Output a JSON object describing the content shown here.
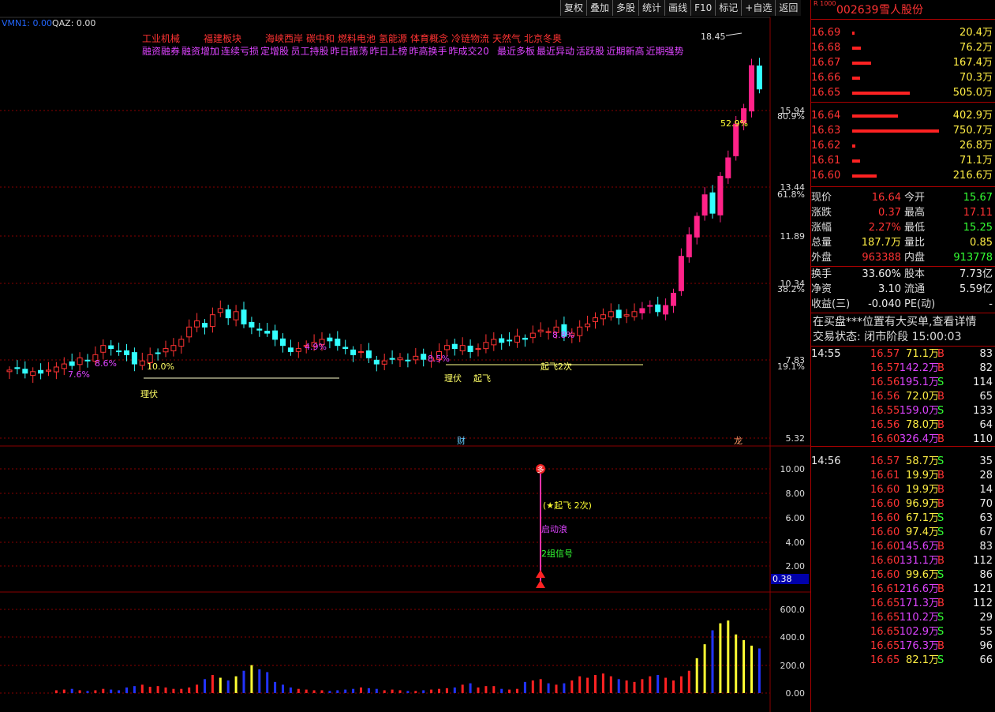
{
  "toolbar": [
    "复权",
    "叠加",
    "多股",
    "统计",
    "画线",
    "F10",
    "标记",
    "+自选",
    "返回"
  ],
  "indicator_line": {
    "vmn": "VMN1: 0.00",
    "qaz": "QAZ: 0.00"
  },
  "concept_row1": [
    "工业机械",
    "福建板块",
    "海峡西岸",
    "碳中和",
    "燃料电池",
    "氢能源",
    "体育概念",
    "冷链物流",
    "天然气",
    "北京冬奥"
  ],
  "concept_row2": [
    "融资融券",
    "融资增加",
    "连续亏损",
    "定增股",
    "员工持股",
    "昨日振荡",
    "昨日上榜",
    "昨高换手",
    "昨成交20",
    "最近多板",
    "最近异动",
    "活跃股",
    "近期新高",
    "近期强势"
  ],
  "stock": {
    "code": "002639",
    "name": "雪人股份",
    "badge": "R 1000"
  },
  "colors": {
    "up": "#ff3333",
    "down": "#33ffff",
    "vol_up": "#ff2222",
    "vol_down": "#2233ff",
    "vol_hot": "#ffff33",
    "grid": "#8a0000"
  },
  "sell_book": [
    {
      "price": "16.69",
      "vol": "20.4万",
      "bar": 3
    },
    {
      "price": "16.68",
      "vol": "76.2万",
      "bar": 10
    },
    {
      "price": "16.67",
      "vol": "167.4万",
      "bar": 22
    },
    {
      "price": "16.66",
      "vol": "70.3万",
      "bar": 9
    },
    {
      "price": "16.65",
      "vol": "505.0万",
      "bar": 66
    }
  ],
  "buy_book": [
    {
      "price": "16.64",
      "vol": "402.9万",
      "bar": 53
    },
    {
      "price": "16.63",
      "vol": "750.7万",
      "bar": 100
    },
    {
      "price": "16.62",
      "vol": "26.8万",
      "bar": 4
    },
    {
      "price": "16.61",
      "vol": "71.1万",
      "bar": 9
    },
    {
      "price": "16.60",
      "vol": "216.6万",
      "bar": 28
    }
  ],
  "quote": [
    {
      "l1": "现价",
      "v1": "16.64",
      "c1": "red",
      "l2": "今开",
      "v2": "15.67",
      "c2": "grn"
    },
    {
      "l1": "涨跌",
      "v1": "0.37",
      "c1": "red",
      "l2": "最高",
      "v2": "17.11",
      "c2": "red"
    },
    {
      "l1": "涨幅",
      "v1": "2.27%",
      "c1": "red",
      "l2": "最低",
      "v2": "15.25",
      "c2": "grn"
    },
    {
      "l1": "总量",
      "v1": "187.7万",
      "c1": "yel",
      "l2": "量比",
      "v2": "0.85",
      "c2": "yel"
    },
    {
      "l1": "外盘",
      "v1": "963388",
      "c1": "red",
      "l2": "内盘",
      "v2": "913778",
      "c2": "grn"
    }
  ],
  "quote2": [
    {
      "l1": "换手",
      "v1": "33.60%",
      "l2": "股本",
      "v2": "7.73亿"
    },
    {
      "l1": "净资",
      "v1": "3.10",
      "l2": "流通",
      "v2": "5.59亿"
    },
    {
      "l1": "收益(三)",
      "v1": "-0.040",
      "l2": "PE(动)",
      "v2": "-"
    }
  ],
  "notes": {
    "bigorder": "在买盘***位置有大买单,查看详情",
    "status": "交易状态: 闭市阶段 15:00:03"
  },
  "ticks": [
    {
      "time": "14:55",
      "price": "16.57",
      "vol": "71.1万",
      "side": "B",
      "n": "83"
    },
    {
      "time": "",
      "price": "16.57",
      "vol": "142.2万",
      "side": "B",
      "n": "82"
    },
    {
      "time": "",
      "price": "16.56",
      "vol": "195.1万",
      "side": "S",
      "n": "114"
    },
    {
      "time": "",
      "price": "16.56",
      "vol": "72.0万",
      "side": "B",
      "n": "65"
    },
    {
      "time": "",
      "price": "16.55",
      "vol": "159.0万",
      "side": "S",
      "n": "133"
    },
    {
      "time": "",
      "price": "16.56",
      "vol": "78.0万",
      "side": "B",
      "n": "64"
    },
    {
      "time": "",
      "price": "16.60",
      "vol": "326.4万",
      "side": "B",
      "n": "110"
    },
    {
      "time": "14:56",
      "price": "16.57",
      "vol": "58.7万",
      "side": "S",
      "n": "35"
    },
    {
      "time": "",
      "price": "16.61",
      "vol": "19.9万",
      "side": "B",
      "n": "28"
    },
    {
      "time": "",
      "price": "16.60",
      "vol": "19.9万",
      "side": "B",
      "n": "14"
    },
    {
      "time": "",
      "price": "16.60",
      "vol": "96.9万",
      "side": "B",
      "n": "70"
    },
    {
      "time": "",
      "price": "16.60",
      "vol": "67.1万",
      "side": "S",
      "n": "63"
    },
    {
      "time": "",
      "price": "16.60",
      "vol": "97.4万",
      "side": "S",
      "n": "67"
    },
    {
      "time": "",
      "price": "16.60",
      "vol": "145.6万",
      "side": "B",
      "n": "83"
    },
    {
      "time": "",
      "price": "16.60",
      "vol": "131.1万",
      "side": "B",
      "n": "112"
    },
    {
      "time": "",
      "price": "16.60",
      "vol": "99.6万",
      "side": "S",
      "n": "86"
    },
    {
      "time": "",
      "price": "16.61",
      "vol": "216.6万",
      "side": "B",
      "n": "121"
    },
    {
      "time": "",
      "price": "16.65",
      "vol": "171.3万",
      "side": "B",
      "n": "112"
    },
    {
      "time": "",
      "price": "16.65",
      "vol": "110.2万",
      "side": "S",
      "n": "29"
    },
    {
      "time": "",
      "price": "16.65",
      "vol": "102.9万",
      "side": "S",
      "n": "55"
    },
    {
      "time": "",
      "price": "16.65",
      "vol": "176.3万",
      "side": "B",
      "n": "96"
    },
    {
      "time": "",
      "price": "16.65",
      "vol": "82.1万",
      "side": "S",
      "n": "66"
    }
  ],
  "chart_data": {
    "type": "candlestick",
    "price_axis_labels": [
      "15.94",
      "13.44",
      "11.89",
      "10.34",
      "7.83",
      "5.32"
    ],
    "pct_axis_labels": [
      "80.9%",
      "61.8%",
      "38.2%",
      "19.1%"
    ],
    "peak_label": "18.45",
    "peak_pct_label": "52.9%",
    "signal_axis_labels": [
      "10.00",
      "8.00",
      "6.00",
      "4.00",
      "2.00"
    ],
    "signal_value": "0.38",
    "volume_axis_labels": [
      "600.0",
      "400.0",
      "200.0",
      "0.00"
    ],
    "annotations": [
      "理伏",
      "10.0%",
      "7.6%",
      "8.6%",
      "4.9%",
      "8.5%",
      "理伏",
      "起飞",
      "起飞2次",
      "8.8%",
      "财",
      "龙"
    ],
    "signal_labels": {
      "marker": "多",
      "line1": "(★起飞 2次)",
      "line2": "启动浪",
      "line3": "2组信号"
    },
    "closes": [
      7.5,
      7.55,
      7.4,
      7.45,
      7.4,
      7.5,
      7.6,
      7.7,
      7.65,
      7.9,
      7.8,
      8.0,
      8.3,
      8.2,
      8.1,
      8.0,
      7.7,
      7.8,
      8.0,
      8.05,
      8.2,
      8.3,
      8.5,
      8.9,
      9.1,
      8.9,
      9.3,
      9.5,
      9.2,
      9.4,
      9.0,
      8.9,
      8.8,
      8.7,
      8.5,
      8.3,
      8.1,
      8.2,
      8.3,
      8.4,
      8.5,
      8.45,
      8.3,
      8.2,
      8.0,
      8.1,
      7.9,
      7.7,
      7.8,
      7.85,
      7.9,
      7.8,
      7.95,
      7.85,
      7.9,
      8.1,
      8.3,
      8.2,
      8.3,
      8.1,
      8.2,
      8.4,
      8.5,
      8.4,
      8.45,
      8.6,
      8.5,
      8.7,
      8.8,
      8.75,
      8.9,
      8.6,
      8.7,
      8.9,
      9.0,
      9.2,
      9.3,
      9.4,
      9.2,
      9.3,
      9.4,
      9.5,
      9.6,
      9.4,
      9.6,
      10.0,
      11.2,
      11.9,
      12.5,
      13.2,
      12.6,
      13.8,
      14.4,
      15.5,
      16.0,
      17.4,
      16.64
    ],
    "volumes": [
      20,
      25,
      30,
      20,
      15,
      20,
      30,
      25,
      20,
      40,
      50,
      60,
      45,
      50,
      40,
      30,
      30,
      40,
      60,
      100,
      130,
      110,
      90,
      120,
      160,
      200,
      170,
      150,
      80,
      60,
      40,
      30,
      25,
      20,
      20,
      15,
      20,
      25,
      30,
      40,
      35,
      30,
      20,
      25,
      20,
      15,
      15,
      20,
      25,
      30,
      35,
      40,
      60,
      70,
      40,
      50,
      50,
      30,
      25,
      30,
      80,
      90,
      100,
      70,
      60,
      70,
      90,
      120,
      110,
      130,
      140,
      120,
      100,
      90,
      80,
      100,
      120,
      130,
      110,
      90,
      120,
      160,
      250,
      350,
      450,
      500,
      520,
      420,
      380,
      340,
      320
    ],
    "hot_from": 82
  }
}
